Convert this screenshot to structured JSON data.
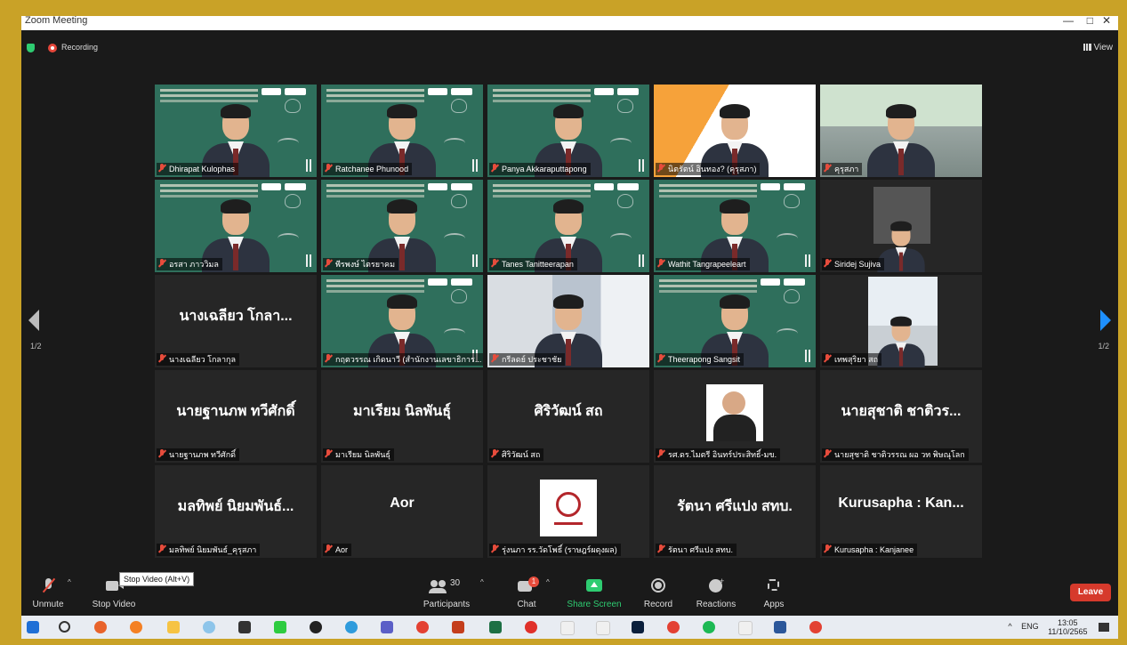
{
  "window": {
    "title": "Zoom Meeting",
    "controls": [
      "—",
      "□",
      "✕"
    ]
  },
  "status": {
    "recording": "Recording",
    "view_label": "View"
  },
  "pager": {
    "left": "1/2",
    "right": "1/2"
  },
  "participants": [
    {
      "name": "Dhirapat Kulophas",
      "video": true,
      "bg": "board"
    },
    {
      "name": "Ratchanee Phunood",
      "video": true,
      "bg": "board"
    },
    {
      "name": "Panya Akkaraputtapong",
      "video": true,
      "bg": "board"
    },
    {
      "name": "นิตรัตน์ อินทอง? (คุรุสภา)",
      "video": true,
      "bg": "orange"
    },
    {
      "name": "คุรุสภา",
      "video": true,
      "bg": "room"
    },
    {
      "name": "อรสา ภาววิมล",
      "video": true,
      "bg": "board"
    },
    {
      "name": "พีรพงษ์ ไตรยาคม",
      "video": true,
      "bg": "board"
    },
    {
      "name": "Tanes Tanitteerapan",
      "video": true,
      "bg": "board"
    },
    {
      "name": "Wathit Tangrapeeleart",
      "video": true,
      "bg": "board"
    },
    {
      "name": "Siridej Sujiva",
      "video": true,
      "bg": "dark-photo"
    },
    {
      "name": "นางเฉลียว โกลากุล",
      "display": "นางเฉลียว  โกลา...",
      "video": false
    },
    {
      "name": "กฤตวรรณ เกิดนาวี (สำนักงานเลขาธิการ...",
      "video": true,
      "bg": "board"
    },
    {
      "name": "กรีลดย์ ประชาชัย",
      "video": true,
      "bg": "office"
    },
    {
      "name": "Theerapong Sangsit",
      "video": true,
      "bg": "board"
    },
    {
      "name": "เทพสุริยา สถ",
      "video": true,
      "bg": "office-photo"
    },
    {
      "name": "นายฐานภพ ทวีศักดิ์",
      "display": "นายฐานภพ ทวีศักดิ์",
      "video": false
    },
    {
      "name": "มาเรียม นิลพันธุ์",
      "display": "มาเรียม นิลพันธุ์",
      "video": false
    },
    {
      "name": "ศิริวัฒน์ สถ",
      "display": "ศิริวัฒน์ สถ",
      "video": false
    },
    {
      "name": "รศ.ดร.ไมตรี อินทร์ประสิทธิ์-มข.",
      "video": false,
      "bg": "photo-card"
    },
    {
      "name": "นายสุชาติ ชาติวรรณ ผอ วท พิษณุโลก",
      "display": "นายสุชาติ  ชาติวร...",
      "video": false
    },
    {
      "name": "มลทิพย์ นิยมพันธ์_คุรุสภา",
      "display": "มลทิพย์ นิยมพันธ์...",
      "video": false
    },
    {
      "name": "Aor",
      "display": "Aor",
      "video": false
    },
    {
      "name": "รุ่งนภา รร.วัดโพธิ์ (ราษฎร์ผดุงผล)",
      "video": false,
      "bg": "logo-card"
    },
    {
      "name": "รัตนา ศรีแปง สทบ.",
      "display": "รัตนา ศรีแปง สทบ.",
      "video": false
    },
    {
      "name": "Kurusapha : Kanjanee",
      "display": "Kurusapha : Kan...",
      "video": false
    }
  ],
  "toolbar": {
    "unmute": "Unmute",
    "stop_video": "Stop Video",
    "stop_video_tooltip": "Stop Video (Alt+V)",
    "participants": "Participants",
    "participants_count": "30",
    "chat": "Chat",
    "chat_badge": "1",
    "share_screen": "Share Screen",
    "record": "Record",
    "reactions": "Reactions",
    "apps": "Apps",
    "leave": "Leave"
  },
  "taskbar": {
    "lang": "ENG",
    "time": "13:05",
    "date": "11/10/2565"
  },
  "colors": {
    "highlight": "#c8e32d",
    "share_green": "#2ecc71",
    "leave_red": "#d63a2c",
    "frame": "#c9a227"
  }
}
